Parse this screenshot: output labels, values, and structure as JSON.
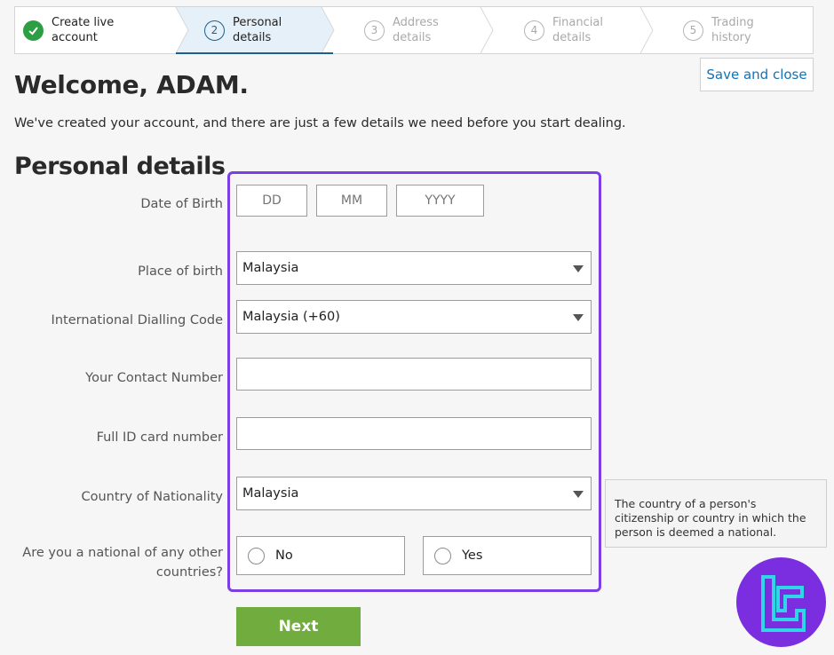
{
  "stepper": {
    "steps": [
      {
        "number": "",
        "label": "Create live\naccount",
        "state": "done"
      },
      {
        "number": "2",
        "label": "Personal\ndetails",
        "state": "active"
      },
      {
        "number": "3",
        "label": "Address\ndetails",
        "state": "pending"
      },
      {
        "number": "4",
        "label": "Financial\ndetails",
        "state": "pending"
      },
      {
        "number": "5",
        "label": "Trading\nhistory",
        "state": "pending"
      }
    ]
  },
  "header": {
    "save_close_label": "Save and close",
    "welcome": "Welcome, ADAM.",
    "subtitle": "We've created your account, and there are just a few details we need before you start dealing."
  },
  "form": {
    "section_title": "Personal details",
    "dob": {
      "label": "Date of Birth",
      "day_placeholder": "DD",
      "month_placeholder": "MM",
      "year_placeholder": "YYYY"
    },
    "place_of_birth": {
      "label": "Place of birth",
      "value": "Malaysia"
    },
    "dialling_code": {
      "label": "International Dialling Code",
      "value": "Malaysia (+60)"
    },
    "contact_number": {
      "label": "Your Contact Number",
      "value": ""
    },
    "id_card": {
      "label": "Full ID card number",
      "value": ""
    },
    "nationality": {
      "label": "Country of Nationality",
      "value": "Malaysia"
    },
    "other_nationality": {
      "label_line1": "Are you a national of any other",
      "label_line2": "countries?",
      "option_no": "No",
      "option_yes": "Yes"
    },
    "tooltip": "The country of a person's citizenship or country in which the person is deemed a national.",
    "next_label": "Next"
  },
  "colors": {
    "accent": "#7b3fe4",
    "next": "#71ac3e",
    "link": "#1273b5",
    "active_step": "#1e5f8e",
    "done": "#2e9e44"
  }
}
